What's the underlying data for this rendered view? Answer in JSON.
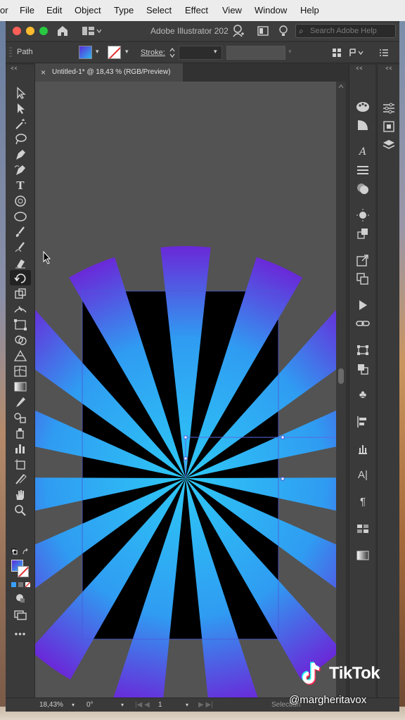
{
  "menubar": {
    "items": [
      "or",
      "File",
      "Edit",
      "Object",
      "Type",
      "Select",
      "Effect",
      "View",
      "Window",
      "Help"
    ]
  },
  "window": {
    "title": "Adobe Illustrator 202",
    "search_placeholder": "Search Adobe Help"
  },
  "controlbar": {
    "object_type": "Path",
    "stroke_label": "Stroke:"
  },
  "document": {
    "tab_title": "Untitled-1* @ 18,43 % (RGB/Preview)"
  },
  "statusbar": {
    "zoom": "18,43%",
    "rotation": "0°",
    "artboard": "1",
    "tool": "Selection"
  },
  "colors": {
    "gradient_start": "#6a28d8",
    "gradient_end": "#2ec8f5",
    "artboard": "#000000",
    "canvas": "#535353"
  },
  "overlay": {
    "brand": "TikTok",
    "handle": "@margheritavox"
  }
}
